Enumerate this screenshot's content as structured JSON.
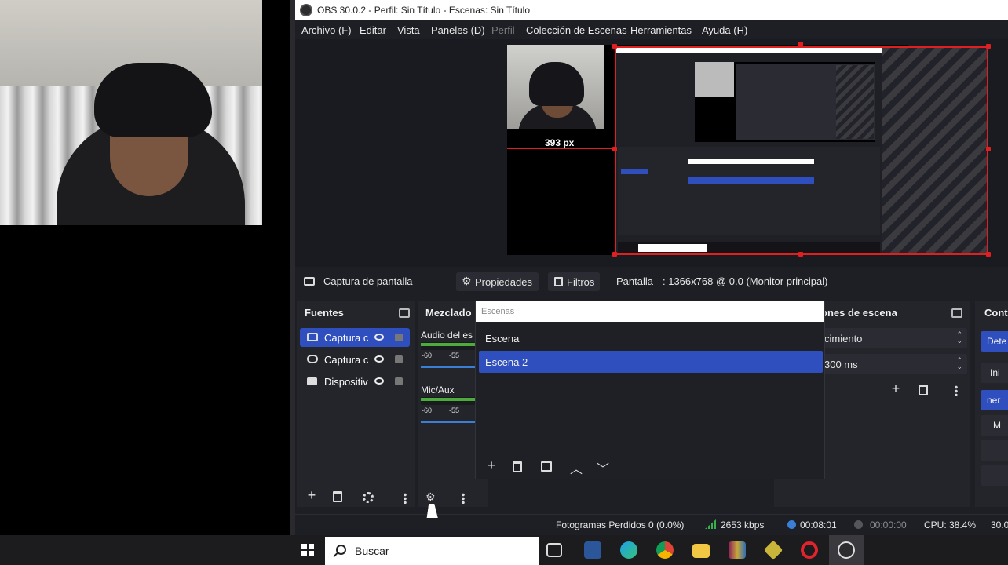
{
  "window": {
    "title": "OBS 30.0.2 - Perfil: Sin Título - Escenas: Sin Título"
  },
  "menu": [
    {
      "label": "Archivo (F)",
      "enabled": true
    },
    {
      "label": "Editar",
      "enabled": true
    },
    {
      "label": "Vista",
      "enabled": true
    },
    {
      "label": "Paneles (D)",
      "enabled": true
    },
    {
      "label": "Perfil",
      "enabled": false
    },
    {
      "label": "Colección de Escenas",
      "enabled": true
    },
    {
      "label": "Herramientas",
      "enabled": true
    },
    {
      "label": "Ayuda (H)",
      "enabled": true
    }
  ],
  "preview": {
    "size_label": "393 px"
  },
  "source_toolbar": {
    "selected_source": "Captura de pantalla",
    "properties": "Propiedades",
    "filters": "Filtros",
    "display_label": "Pantalla",
    "display_value": ": 1366x768 @ 0.0 (Monitor principal)"
  },
  "sources_dock": {
    "title": "Fuentes",
    "items": [
      {
        "label": "Captura c",
        "icon": "monitor-icon",
        "selected": true
      },
      {
        "label": "Captura c",
        "icon": "gamepad-icon",
        "selected": false
      },
      {
        "label": "Dispositiv",
        "icon": "camera-icon",
        "selected": false
      }
    ]
  },
  "mixer_dock": {
    "title": "Mezclado",
    "channels": [
      {
        "name": "Audio del es",
        "ticks": [
          "-60",
          "-55"
        ]
      },
      {
        "name": "Mic/Aux",
        "ticks": [
          "-60",
          "-55"
        ]
      }
    ]
  },
  "scenes_popup": {
    "search_placeholder": "Escenas",
    "items": [
      {
        "label": "Escena",
        "selected": false
      },
      {
        "label": "Escena 2",
        "selected": true
      }
    ]
  },
  "transitions_dock": {
    "title": "ones de escena",
    "transition": "cimiento",
    "duration": "300 ms"
  },
  "controls_dock": {
    "title": "Cont",
    "buttons": [
      "Dete",
      "Ini",
      "ner",
      "M"
    ]
  },
  "status": {
    "dropped_frames": "Fotogramas Perdidos 0 (0.0%)",
    "bitrate": "2653 kbps",
    "stream_time": "00:08:01",
    "rec_time": "00:00:00",
    "cpu": "CPU: 38.4%",
    "fps": "30.0"
  },
  "taskbar": {
    "search_label": "Buscar",
    "apps": [
      "task-view-icon",
      "word-icon",
      "edge-icon",
      "chrome-icon",
      "file-explorer-icon",
      "winrar-icon",
      "layers-app-icon",
      "opera-icon",
      "obs-icon"
    ]
  },
  "colors": {
    "accent": "#2f4fbf",
    "selection_red": "#e02020",
    "meter_green": "#4cab3c",
    "background": "#1e1f24"
  }
}
